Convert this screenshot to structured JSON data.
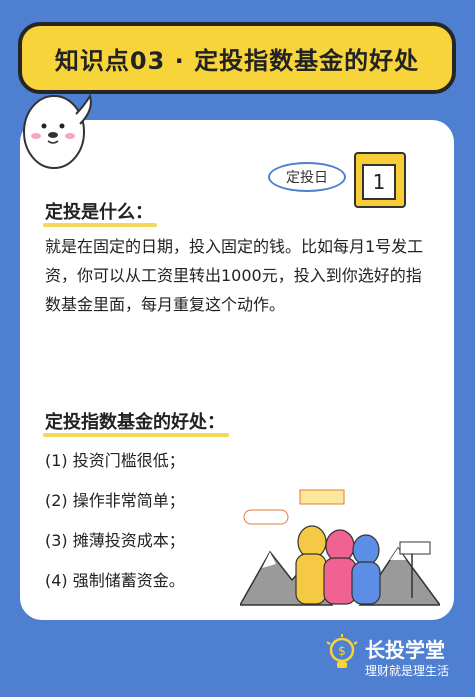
{
  "banner": {
    "title": "知识点03 · 定投指数基金的好处"
  },
  "calendar": {
    "tag": "定投日",
    "day": "1"
  },
  "section1": {
    "heading": "定投是什么：",
    "body": "就是在固定的日期，投入固定的钱。比如每月1号发工资，你可以从工资里转出1000元，投入到你选好的指数基金里面，每月重复这个动作。"
  },
  "section2": {
    "heading": "定投指数基金的好处：",
    "items": [
      "(1) 投资门槛很低；",
      "(2) 操作非常简单；",
      "(3) 摊薄投资成本；",
      "(4) 强制储蓄资金。"
    ]
  },
  "footer": {
    "brand": "长投学堂",
    "slogan": "理财就是理生活"
  },
  "colors": {
    "background": "#4f7fd0",
    "banner": "#f7d53a",
    "highlight": "#f3d95a"
  }
}
